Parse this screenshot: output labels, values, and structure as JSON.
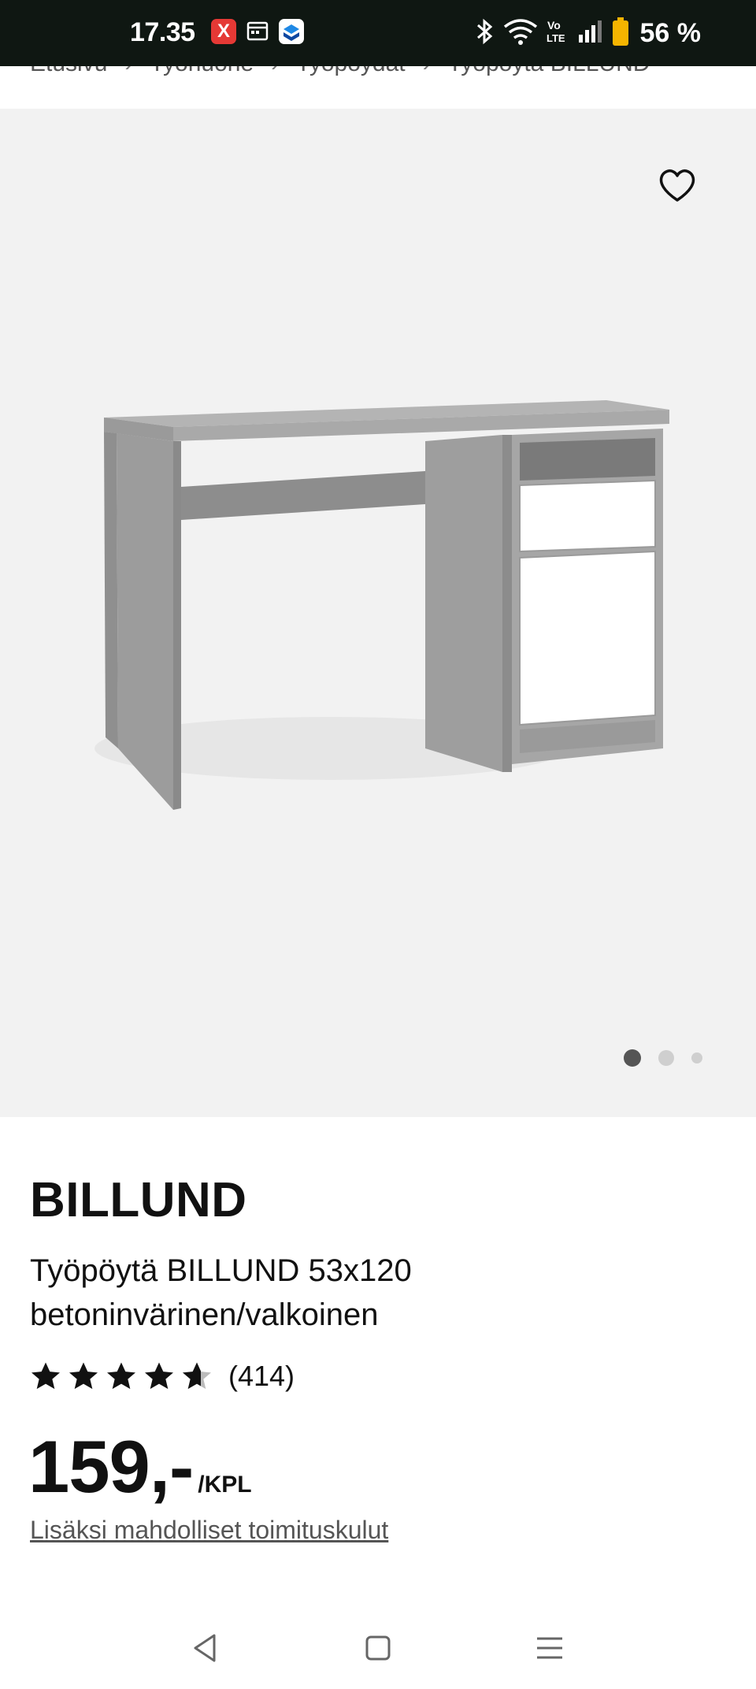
{
  "status_bar": {
    "time": "17.35",
    "app_badge": "X",
    "battery": "56 %",
    "icons": [
      "x-app-icon",
      "calendar-icon",
      "app-icon",
      "bluetooth-icon",
      "wifi-icon",
      "volte-icon",
      "signal-icon",
      "battery-icon"
    ]
  },
  "breadcrumb": {
    "items": [
      "Etusivu",
      "Työhuone",
      "Työpöydät",
      "Työpöytä BILLUND"
    ]
  },
  "gallery": {
    "slide_count": 3,
    "active_slide": 1
  },
  "product": {
    "brand": "BILLUND",
    "description": "Työpöytä BILLUND 53x120 betoninvärinen/valkoinen",
    "rating": 4.5,
    "review_count": "(414)",
    "price": "159,-",
    "price_unit": "/KPL",
    "shipping_note": "Lisäksi mahdolliset toimituskulut"
  },
  "colors": {
    "status_bar": "#0f1712",
    "gallery_bg": "#f2f2f2",
    "text": "#111111",
    "muted": "#555555"
  }
}
